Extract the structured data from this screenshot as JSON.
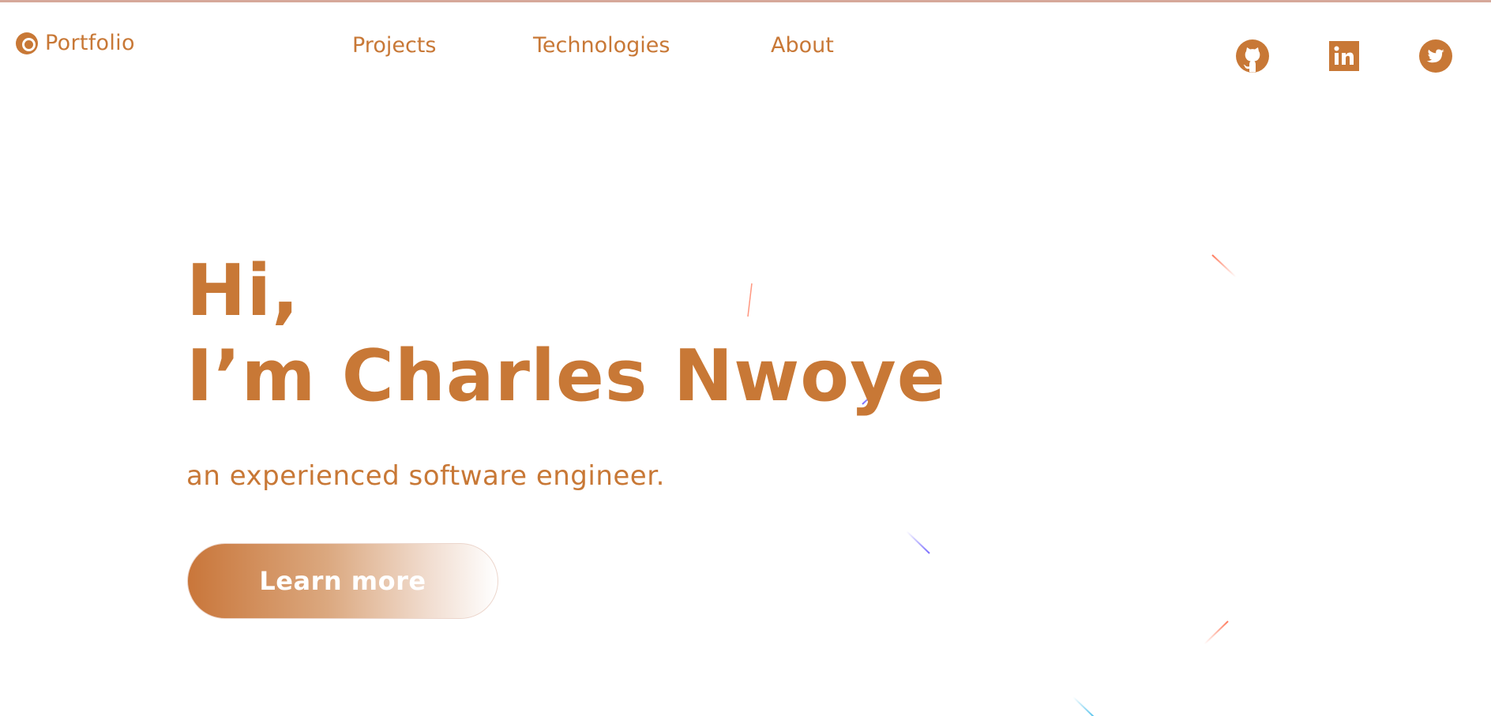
{
  "brand": {
    "name": "Portfolio",
    "icon": "portfolio-logo-icon"
  },
  "nav": {
    "items": [
      {
        "label": "Projects"
      },
      {
        "label": "Technologies"
      },
      {
        "label": "About"
      }
    ]
  },
  "social": [
    {
      "icon": "github-icon"
    },
    {
      "icon": "linkedin-icon"
    },
    {
      "icon": "twitter-icon"
    }
  ],
  "hero": {
    "greeting": "Hi,",
    "name_line": "I’m Charles Nwoye",
    "subtitle": "an experienced software engineer.",
    "cta_label": "Learn more"
  },
  "colors": {
    "accent": "#c87836",
    "background": "#ffffff",
    "top_border": "#d6a89a"
  }
}
